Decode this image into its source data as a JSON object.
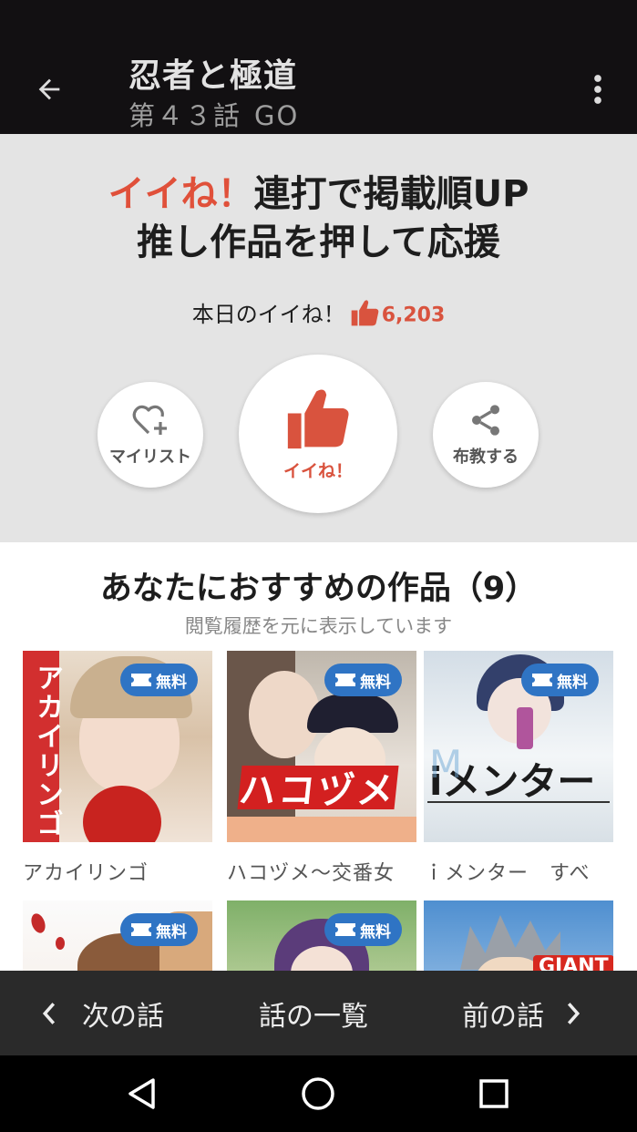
{
  "appbar": {
    "title": "忍者と極道",
    "episode": "第４３話",
    "subtitle_extra": "GO",
    "back_icon": "arrow-left-icon",
    "more_icon": "more-vert-icon"
  },
  "like_panel": {
    "headline_accent": "イイね！",
    "headline_rest": "連打で掲載順UP",
    "headline_line2": "推し作品を押して応援",
    "today_label": "本日のイイね！",
    "today_count": "6,203",
    "buttons": {
      "mylist": "マイリスト",
      "like": "イイね！",
      "share": "布教する"
    }
  },
  "recommendations": {
    "title": "あなたにおすすめの作品（9）",
    "subtitle": "閲覧履歴を元に表示しています",
    "badge_label": "無料",
    "items": [
      {
        "title": "アカイリンゴ",
        "cover_text": "アカイリンゴ"
      },
      {
        "title": "ハコヅメ〜交番女",
        "cover_text": "ハコヅメ"
      },
      {
        "title": "ｉメンター　すべ",
        "cover_text": "iメンター"
      },
      {
        "title": ""
      },
      {
        "title": ""
      },
      {
        "title": "",
        "cover_text": "GIANT"
      }
    ]
  },
  "bottom_nav": {
    "next": "次の話",
    "list": "話の一覧",
    "prev": "前の話"
  },
  "colors": {
    "accent_red": "#e0503a",
    "badge_blue": "#2f74c4",
    "appbar_bg": "#121012",
    "panel_bg": "#e4e4e4"
  }
}
